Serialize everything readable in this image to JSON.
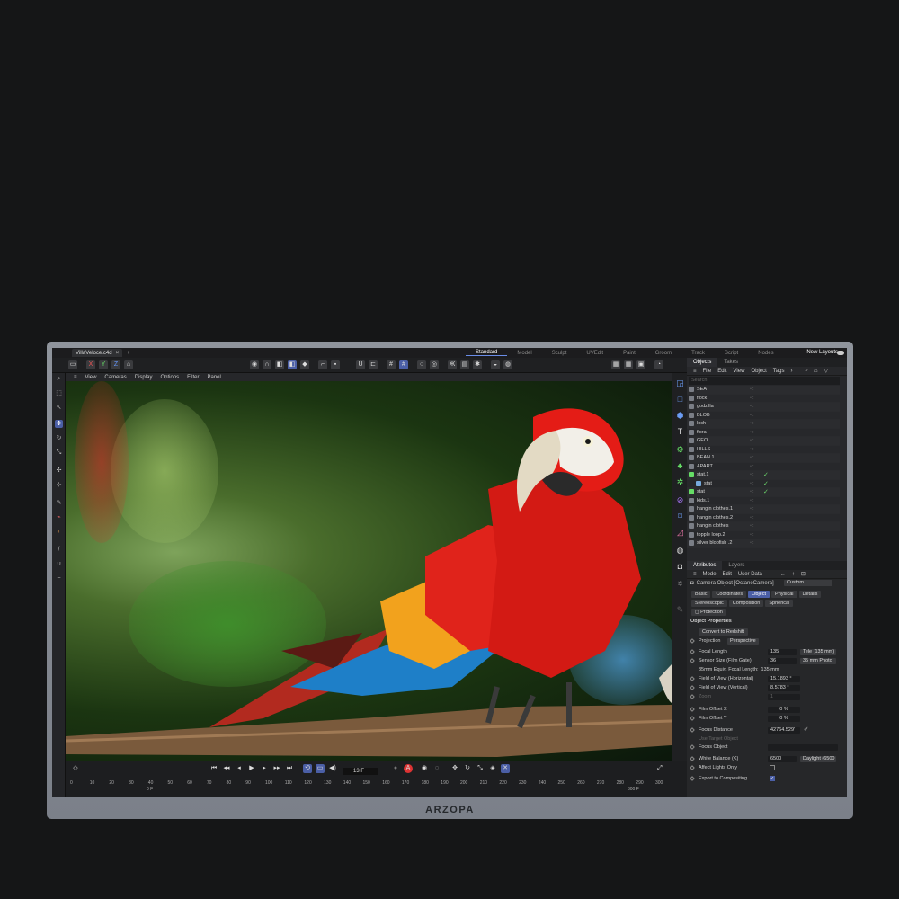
{
  "brand": "ARZOPA",
  "titlebar": {
    "file_tab": "VillaVeloce.c4d",
    "close": "×",
    "plus": "+",
    "layouts": [
      "Standard",
      "Model",
      "Sculpt",
      "UVEdit",
      "Paint",
      "Groom",
      "Track",
      "Script",
      "Nodes"
    ],
    "active_layout": "Standard",
    "new_layouts": "New Layouts"
  },
  "toolbar": {
    "axis_x": "X",
    "axis_y": "Y",
    "axis_z": "Z"
  },
  "viewport_menu": [
    "View",
    "Cameras",
    "Display",
    "Options",
    "Filter",
    "Panel"
  ],
  "objects_panel": {
    "tabs": [
      "Objects",
      "Takes"
    ],
    "menu": [
      "File",
      "Edit",
      "View",
      "Object",
      "Tags"
    ],
    "search_placeholder": "Search",
    "items": [
      "SEA",
      "flock",
      "godzilla",
      "BLOB",
      "loch",
      "flora",
      "GEO",
      "HILLS",
      "BEAN.1",
      "APART",
      "stat.1",
      "stat",
      "stat",
      "kids.1",
      "hangin clothes.1",
      "hangin clothes.2",
      "hangin clothes",
      "topple loop.2",
      "silver blobfish .2"
    ]
  },
  "attributes_panel": {
    "tabs": [
      "Attributes",
      "Layers"
    ],
    "menu": [
      "Mode",
      "Edit",
      "User Data"
    ],
    "object_type": "Camera Object [OctaneCamera]",
    "custom": "Custom",
    "subtabs": [
      "Basic",
      "Coordinates",
      "Object",
      "Physical",
      "Details"
    ],
    "active_subtab": "Object",
    "subtabs2": [
      "Stereoscopic",
      "Composition",
      "Spherical"
    ],
    "protection": "Protection",
    "section_title": "Object Properties",
    "convert": "Convert to Redshift",
    "props": {
      "projection": "Projection",
      "projection_val": "Perspective",
      "focal": "Focal Length",
      "focal_val": "135",
      "focal_preset": "Tele (135 mm)",
      "sensor": "Sensor Size (Film Gate)",
      "sensor_val": "36",
      "sensor_preset": "35 mm Photo",
      "equiv": "35mm Equiv. Focal Length:",
      "equiv_val": "135 mm",
      "fovh": "Field of View (Horizontal)",
      "fovh_val": "15.1893 °",
      "fovv": "Field of View (Vertical)",
      "fovv_val": "8.5783 °",
      "zoom": "Zoom",
      "zoom_val": "1",
      "offx": "Film Offset X",
      "offx_val": "0 %",
      "offy": "Film Offset Y",
      "offy_val": "0 %",
      "focus": "Focus Distance",
      "focus_val": "42764.529'",
      "use_target": "Use Target Object",
      "focus_obj": "Focus Object",
      "wb": "White Balance (K)",
      "wb_val": "6500",
      "wb_preset": "Daylight (6500 K)",
      "affect": "Affect Lights Only",
      "export": "Export to Compositing"
    }
  },
  "timeline": {
    "frame": "13 F",
    "ticks": [
      "0",
      "10",
      "20",
      "30",
      "40",
      "50",
      "60",
      "70",
      "80",
      "90",
      "100",
      "110",
      "120",
      "130",
      "140",
      "150",
      "160",
      "170",
      "180",
      "190",
      "200",
      "210",
      "220",
      "230",
      "240",
      "250",
      "260",
      "270",
      "280",
      "290",
      "300"
    ],
    "start": "0 F",
    "end": "300 F"
  }
}
